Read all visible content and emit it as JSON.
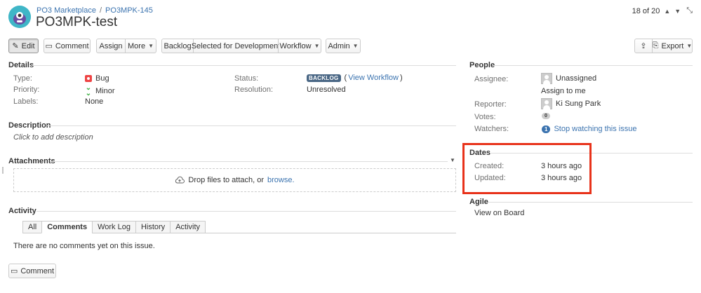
{
  "header": {
    "breadcrumb_project": "PO3 Marketplace",
    "breadcrumb_separator": "/",
    "breadcrumb_issue": "PO3MPK-145",
    "title": "PO3MPK-test",
    "pager_text": "18 of 20"
  },
  "toolbar": {
    "edit": "Edit",
    "comment": "Comment",
    "assign": "Assign",
    "more": "More",
    "backlog": "Backlog",
    "selected_for_development": "Selected for Development",
    "workflow": "Workflow",
    "admin": "Admin",
    "export": "Export"
  },
  "details": {
    "heading": "Details",
    "type_label": "Type:",
    "type_value": "Bug",
    "priority_label": "Priority:",
    "priority_value": "Minor",
    "labels_label": "Labels:",
    "labels_value": "None",
    "status_label": "Status:",
    "status_lozenge": "BACKLOG",
    "status_open_paren": "(",
    "view_workflow": "View Workflow",
    "status_close_paren": ")",
    "resolution_label": "Resolution:",
    "resolution_value": "Unresolved"
  },
  "description": {
    "heading": "Description",
    "placeholder": "Click to add description"
  },
  "attachments": {
    "heading": "Attachments",
    "drop_text": "Drop files to attach, or",
    "browse": "browse."
  },
  "activity": {
    "heading": "Activity",
    "tabs": [
      "All",
      "Comments",
      "Work Log",
      "History",
      "Activity"
    ],
    "active_tab": "Comments",
    "empty_text": "There are no comments yet on this issue.",
    "comment_button": "Comment"
  },
  "people": {
    "heading": "People",
    "assignee_label": "Assignee:",
    "assignee_value": "Unassigned",
    "assign_to_me": "Assign to me",
    "reporter_label": "Reporter:",
    "reporter_value": "Ki Sung Park",
    "votes_label": "Votes:",
    "votes_count": "0",
    "watchers_label": "Watchers:",
    "watchers_count": "1",
    "stop_watching": "Stop watching this issue"
  },
  "dates": {
    "heading": "Dates",
    "created_label": "Created:",
    "created_value": "3 hours ago",
    "updated_label": "Updated:",
    "updated_value": "3 hours ago"
  },
  "agile": {
    "heading": "Agile",
    "view_on_board": "View on Board"
  },
  "colors": {
    "link": "#3b73af",
    "bug": "#e44444",
    "minor": "#3cb043",
    "lozenge": "#4a6785",
    "highlight": "#e8321a",
    "avatar": "#3fb6c7"
  }
}
